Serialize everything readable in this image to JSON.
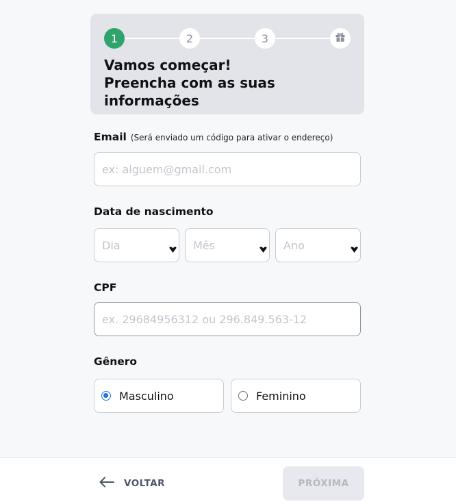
{
  "stepper": {
    "steps": [
      "1",
      "2",
      "3"
    ],
    "final_step_icon": "gift-icon",
    "active_step": 1
  },
  "header": {
    "title_line1": "Vamos começar!",
    "title_line2": "Preencha com as suas",
    "title_line3": "informações"
  },
  "form": {
    "email": {
      "label": "Email",
      "hint": "(Será enviado um código para ativar o endereço)",
      "placeholder": "ex: alguem@gmail.com"
    },
    "birthdate": {
      "label": "Data de nascimento",
      "day_placeholder": "Dia",
      "month_placeholder": "Mês",
      "year_placeholder": "Ano"
    },
    "cpf": {
      "label": "CPF",
      "placeholder": "ex. 29684956312 ou 296.849.563-12"
    },
    "gender": {
      "label": "Gênero",
      "options": [
        "Masculino",
        "Feminino"
      ],
      "selected": "Masculino"
    }
  },
  "footer": {
    "back_label": "VOLTAR",
    "next_label": "PRÓXIMA"
  },
  "colors": {
    "accent_green": "#2fa36b",
    "radio_blue": "#1a73e8",
    "header_bg": "#e2e4ea"
  }
}
